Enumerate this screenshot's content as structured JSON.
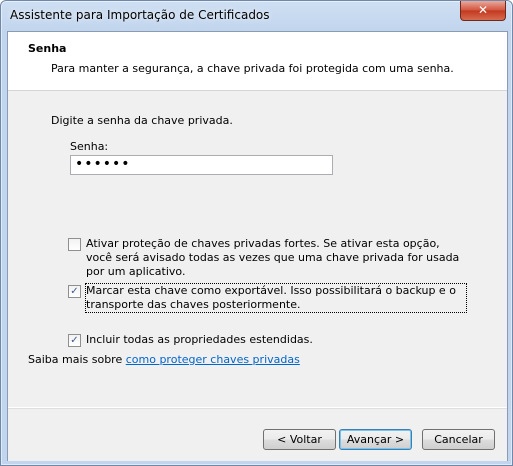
{
  "window": {
    "title": "Assistente para Importação de Certificados",
    "close_label": "✕"
  },
  "header": {
    "title": "Senha",
    "description": "Para manter a segurança, a chave privada foi protegida com uma senha."
  },
  "main": {
    "prompt": "Digite a senha da chave privada.",
    "password_label": "Senha:",
    "password_value": "••••••",
    "options": [
      {
        "label": "Ativar proteção de chaves privadas fortes. Se ativar esta opção, você será avisado todas as vezes que uma chave privada for usada por um aplicativo.",
        "checked": false
      },
      {
        "label": "Marcar esta chave como exportável. Isso possibilitará o backup e o transporte das chaves posteriormente.",
        "checked": true
      },
      {
        "label": "Incluir todas as propriedades estendidas.",
        "checked": true
      }
    ],
    "learn_more_prefix": "Saiba mais sobre ",
    "learn_more_link": "como proteger chaves privadas"
  },
  "footer": {
    "back_label": "< Voltar",
    "next_label": "Avançar >",
    "cancel_label": "Cancelar"
  },
  "icons": {
    "check_glyph": "✓"
  }
}
